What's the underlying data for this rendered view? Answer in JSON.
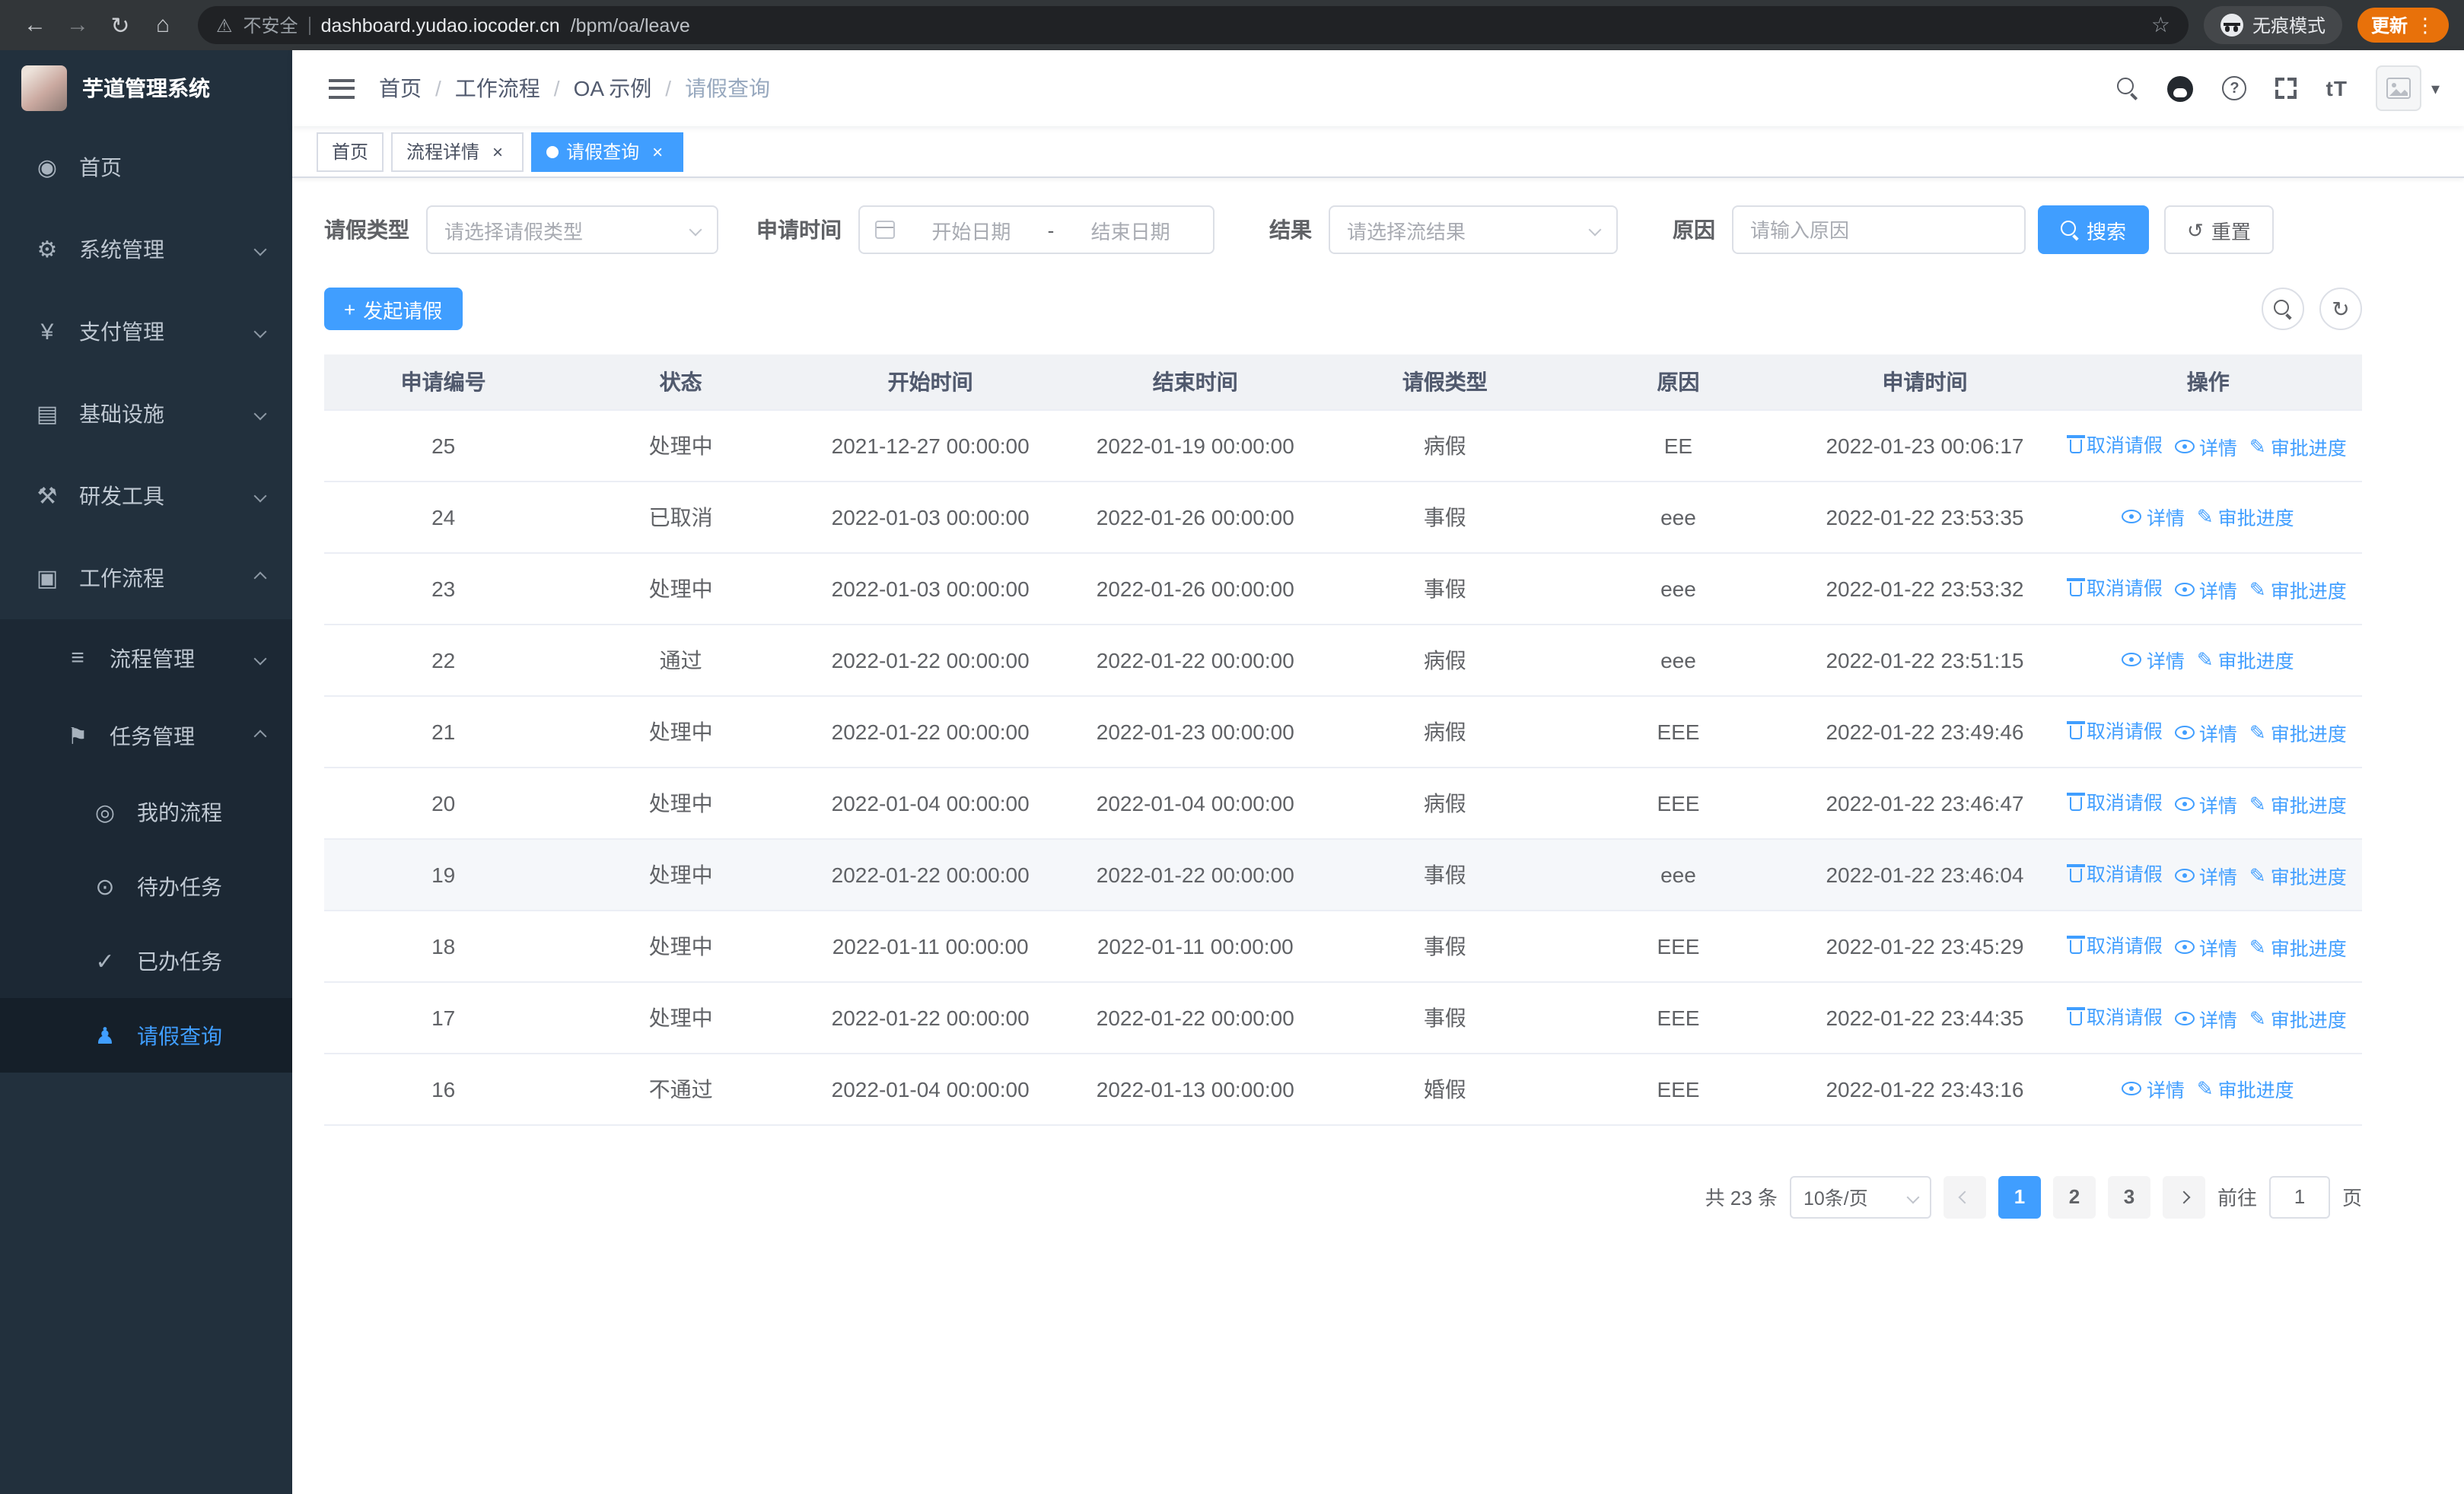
{
  "browser": {
    "security_label": "不安全",
    "url_domain": "dashboard.yudao.iocoder.cn",
    "url_path": "/bpm/oa/leave",
    "incognito_label": "无痕模式",
    "update_label": "更新"
  },
  "icons": {
    "back": "←",
    "forward": "→",
    "reload": "↻",
    "home": "⌂",
    "warning": "⚠",
    "star": "☆",
    "dots": "⋮",
    "question": "?",
    "text_size": "tT",
    "caret_down": "▾",
    "plus": "+",
    "close": "×",
    "refresh": "↻",
    "reset": "↺",
    "edit": "✎",
    "menu_home": "◉",
    "menu_system": "⚙",
    "menu_payment": "¥",
    "menu_infra": "▤",
    "menu_devtools": "⚒",
    "menu_workflow": "▣",
    "menu_process": "≡",
    "menu_task": "⚑",
    "menu_my_process": "◎",
    "menu_todo": "⊙",
    "menu_done": "✓",
    "menu_leave": "♟"
  },
  "colors": {
    "accent": "#409eff",
    "sidebar_bg": "#22303d",
    "update_badge": "#e8710a"
  },
  "sidebar": {
    "logo_title": "芋道管理系统",
    "home": "首页",
    "system": "系统管理",
    "payment": "支付管理",
    "infra": "基础设施",
    "devtools": "研发工具",
    "workflow": "工作流程",
    "process_mgmt": "流程管理",
    "task_mgmt": "任务管理",
    "my_process": "我的流程",
    "todo_tasks": "待办任务",
    "done_tasks": "已办任务",
    "leave_query": "请假查询"
  },
  "header": {
    "breadcrumb": [
      "首页",
      "工作流程",
      "OA 示例",
      "请假查询"
    ],
    "separator": "/"
  },
  "tabs": [
    {
      "label": "首页",
      "active": false,
      "closable": false
    },
    {
      "label": "流程详情",
      "active": false,
      "closable": true
    },
    {
      "label": "请假查询",
      "active": true,
      "closable": true
    }
  ],
  "filters": {
    "leave_type_label": "请假类型",
    "leave_type_placeholder": "请选择请假类型",
    "apply_time_label": "申请时间",
    "start_date_placeholder": "开始日期",
    "date_separator": "-",
    "end_date_placeholder": "结束日期",
    "result_label": "结果",
    "result_placeholder": "请选择流结果",
    "reason_label": "原因",
    "reason_placeholder": "请输入原因",
    "search_button": "搜索",
    "reset_button": "重置"
  },
  "toolbar": {
    "create_button": "发起请假"
  },
  "table": {
    "columns": [
      "申请编号",
      "状态",
      "开始时间",
      "结束时间",
      "请假类型",
      "原因",
      "申请时间",
      "操作"
    ],
    "action_labels": {
      "cancel": "取消请假",
      "detail": "详情",
      "progress": "审批进度"
    },
    "rows": [
      {
        "id": "25",
        "status": "处理中",
        "start": "2021-12-27 00:00:00",
        "end": "2022-01-19 00:00:00",
        "type": "病假",
        "reason": "EE",
        "applied": "2022-01-23 00:06:17",
        "actions": [
          "cancel",
          "detail",
          "progress"
        ]
      },
      {
        "id": "24",
        "status": "已取消",
        "start": "2022-01-03 00:00:00",
        "end": "2022-01-26 00:00:00",
        "type": "事假",
        "reason": "eee",
        "applied": "2022-01-22 23:53:35",
        "actions": [
          "detail",
          "progress"
        ]
      },
      {
        "id": "23",
        "status": "处理中",
        "start": "2022-01-03 00:00:00",
        "end": "2022-01-26 00:00:00",
        "type": "事假",
        "reason": "eee",
        "applied": "2022-01-22 23:53:32",
        "actions": [
          "cancel",
          "detail",
          "progress"
        ]
      },
      {
        "id": "22",
        "status": "通过",
        "start": "2022-01-22 00:00:00",
        "end": "2022-01-22 00:00:00",
        "type": "病假",
        "reason": "eee",
        "applied": "2022-01-22 23:51:15",
        "actions": [
          "detail",
          "progress"
        ]
      },
      {
        "id": "21",
        "status": "处理中",
        "start": "2022-01-22 00:00:00",
        "end": "2022-01-23 00:00:00",
        "type": "病假",
        "reason": "EEE",
        "applied": "2022-01-22 23:49:46",
        "actions": [
          "cancel",
          "detail",
          "progress"
        ]
      },
      {
        "id": "20",
        "status": "处理中",
        "start": "2022-01-04 00:00:00",
        "end": "2022-01-04 00:00:00",
        "type": "病假",
        "reason": "EEE",
        "applied": "2022-01-22 23:46:47",
        "actions": [
          "cancel",
          "detail",
          "progress"
        ]
      },
      {
        "id": "19",
        "status": "处理中",
        "start": "2022-01-22 00:00:00",
        "end": "2022-01-22 00:00:00",
        "type": "事假",
        "reason": "eee",
        "applied": "2022-01-22 23:46:04",
        "actions": [
          "cancel",
          "detail",
          "progress"
        ],
        "highlight": true
      },
      {
        "id": "18",
        "status": "处理中",
        "start": "2022-01-11 00:00:00",
        "end": "2022-01-11 00:00:00",
        "type": "事假",
        "reason": "EEE",
        "applied": "2022-01-22 23:45:29",
        "actions": [
          "cancel",
          "detail",
          "progress"
        ]
      },
      {
        "id": "17",
        "status": "处理中",
        "start": "2022-01-22 00:00:00",
        "end": "2022-01-22 00:00:00",
        "type": "事假",
        "reason": "EEE",
        "applied": "2022-01-22 23:44:35",
        "actions": [
          "cancel",
          "detail",
          "progress"
        ]
      },
      {
        "id": "16",
        "status": "不通过",
        "start": "2022-01-04 00:00:00",
        "end": "2022-01-13 00:00:00",
        "type": "婚假",
        "reason": "EEE",
        "applied": "2022-01-22 23:43:16",
        "actions": [
          "detail",
          "progress"
        ]
      }
    ]
  },
  "pagination": {
    "total_label": "共 23 条",
    "page_size": "10条/页",
    "pages": [
      "1",
      "2",
      "3"
    ],
    "active_page": "1",
    "goto_label": "前往",
    "goto_value": "1",
    "goto_suffix": "页"
  }
}
